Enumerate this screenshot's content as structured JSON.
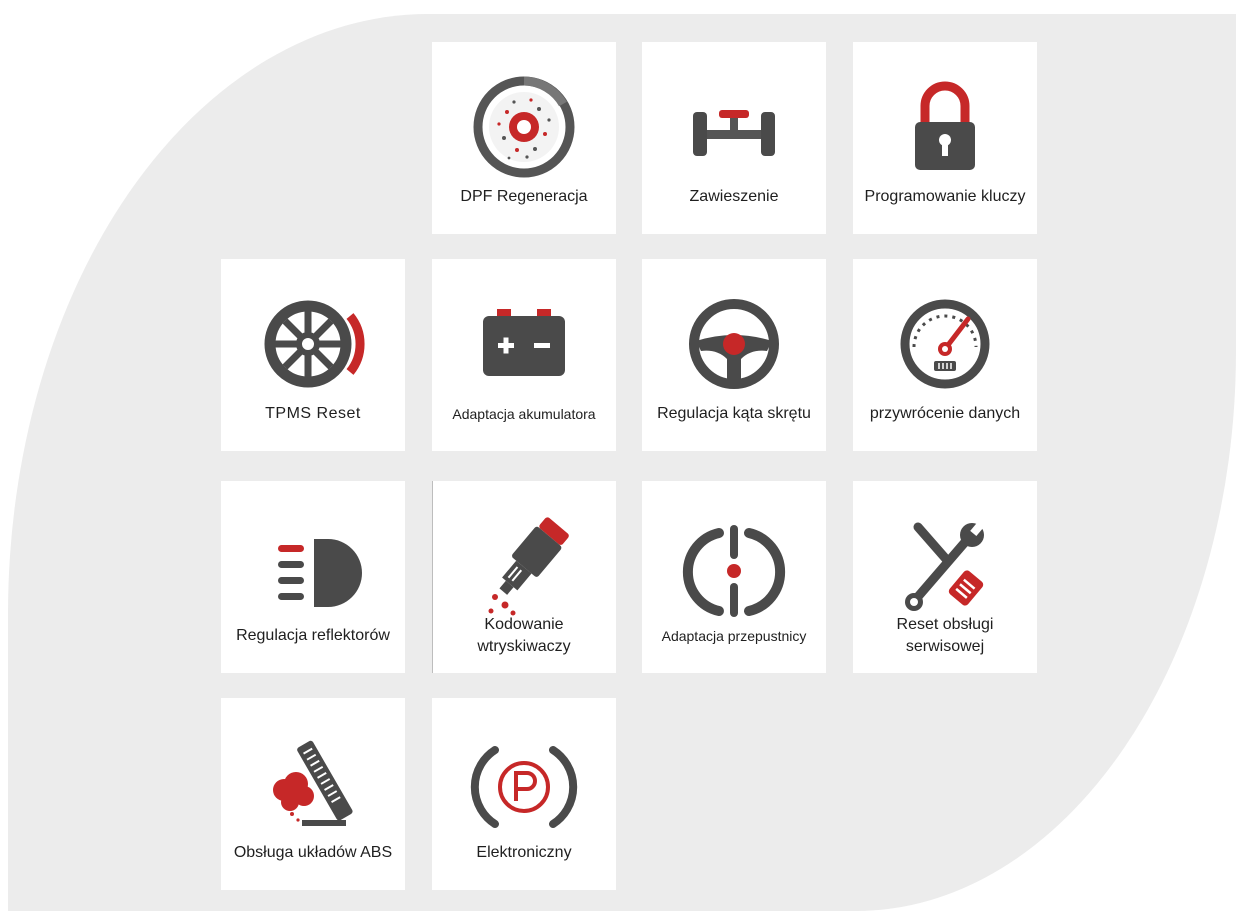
{
  "colors": {
    "red": "#c62828",
    "dark": "#4a4a4a",
    "background": "#ececec",
    "tile": "#ffffff"
  },
  "tiles": [
    {
      "label": "DPF Regeneracja",
      "icon": "dpf-filter-icon"
    },
    {
      "label": "Zawieszenie",
      "icon": "suspension-axle-icon"
    },
    {
      "label": "Programowanie kluczy",
      "icon": "padlock-icon"
    },
    {
      "label": "TPMS Reset",
      "icon": "tire-pressure-icon"
    },
    {
      "label": "Adaptacja akumulatora",
      "icon": "battery-icon"
    },
    {
      "label": "Regulacja kąta skrętu",
      "icon": "steering-wheel-icon"
    },
    {
      "label": "przywrócenie danych",
      "icon": "gauge-icon"
    },
    {
      "label": "Regulacja reflektorów",
      "icon": "headlight-icon"
    },
    {
      "label": "Kodowanie wtryskiwaczy",
      "icon": "injector-icon"
    },
    {
      "label": "Adaptacja przepustnicy",
      "icon": "throttle-icon"
    },
    {
      "label": "Reset obsługi serwisowej",
      "icon": "wrench-screwdriver-icon"
    },
    {
      "label": "Obsługa układów ABS",
      "icon": "brake-pedal-icon"
    },
    {
      "label": "Elektroniczny",
      "icon": "parking-brake-icon"
    }
  ]
}
